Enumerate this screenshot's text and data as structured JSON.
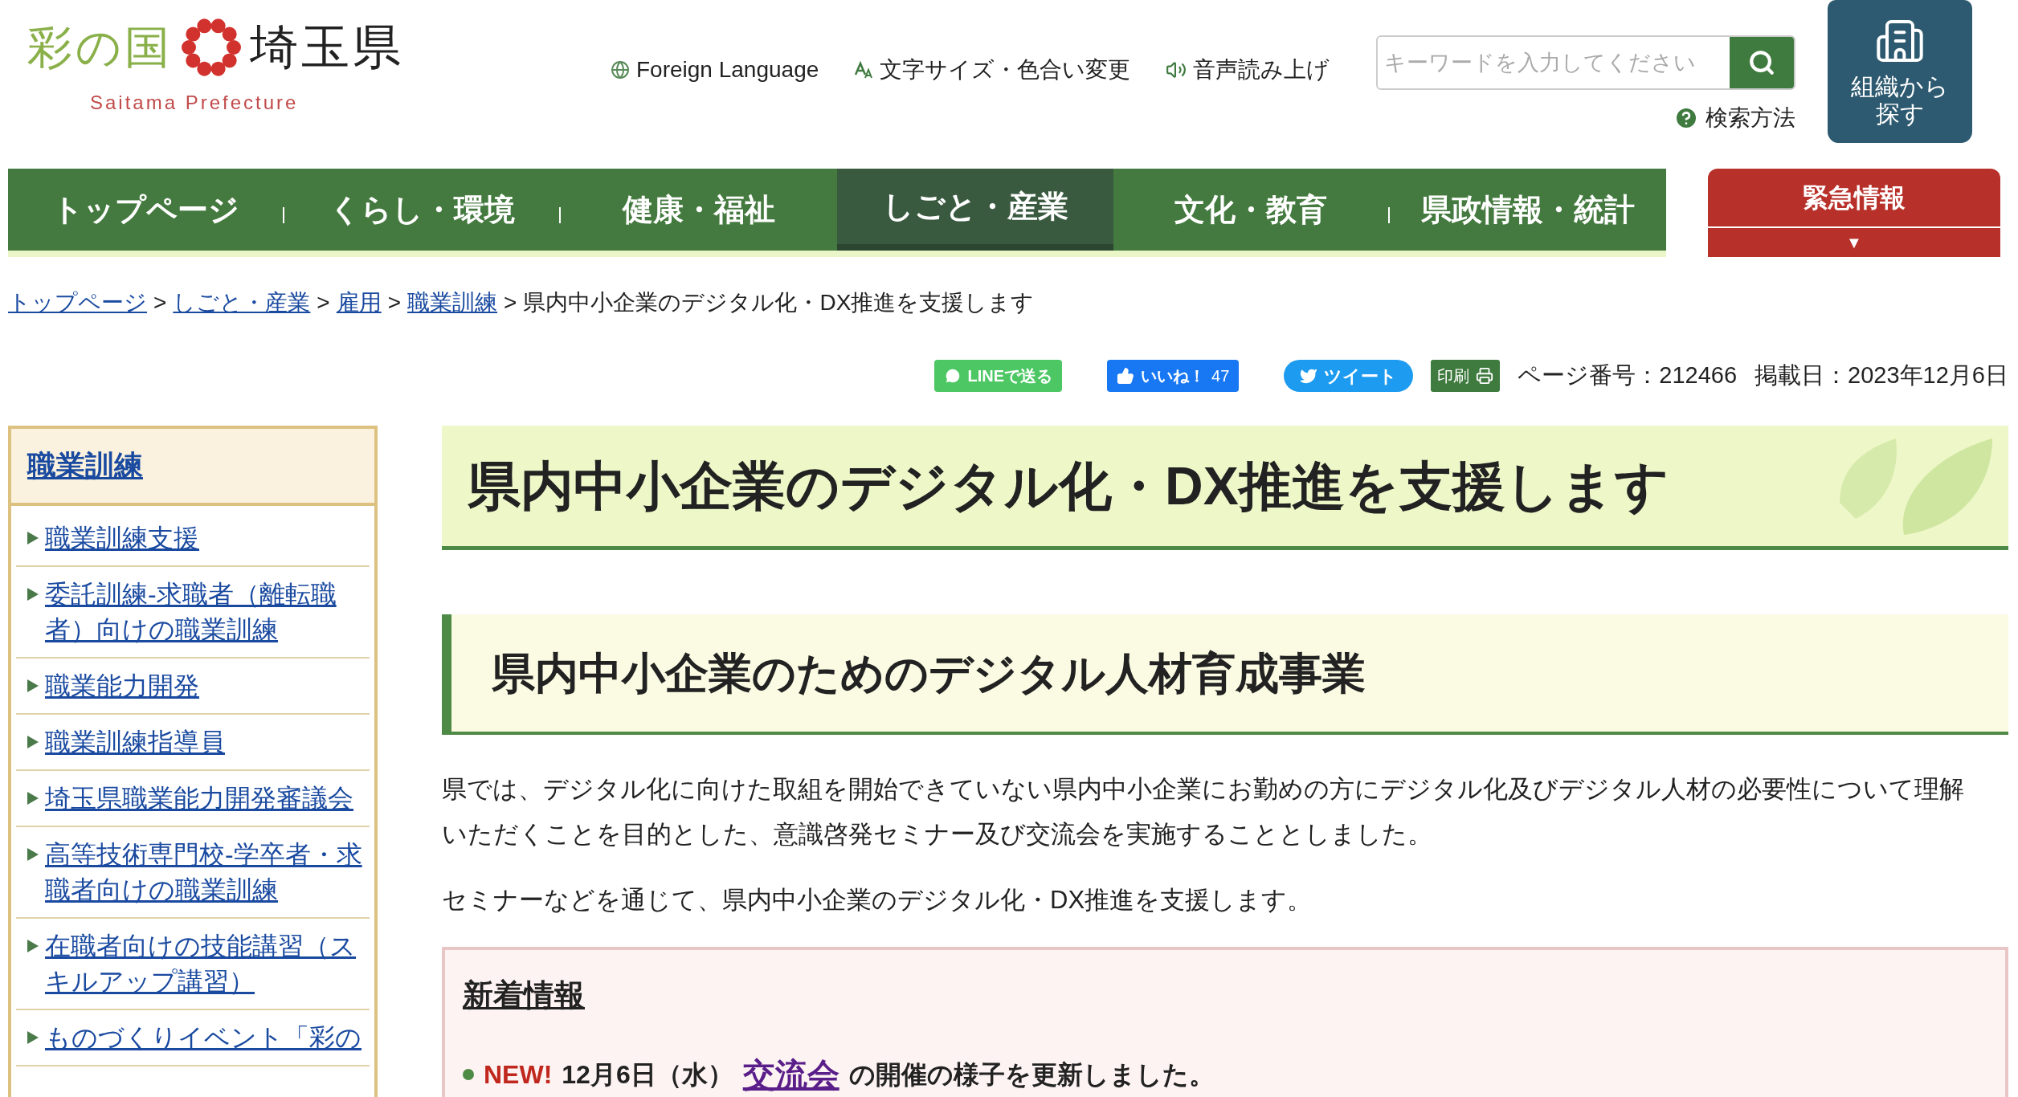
{
  "logo": {
    "mark_text": "彩の国",
    "name": "埼玉県",
    "subtitle": "Saitama Prefecture"
  },
  "header_links": [
    {
      "kind": "globe",
      "label": "Foreign Language"
    },
    {
      "kind": "text-size",
      "label": "文字サイズ・色合い変更"
    },
    {
      "kind": "speaker",
      "label": "音声読み上げ"
    }
  ],
  "search": {
    "placeholder": "キーワードを入力してください",
    "help": "検索方法"
  },
  "org_button": {
    "label": "組織から探す"
  },
  "nav": [
    {
      "label": "トップページ",
      "selected": false
    },
    {
      "label": "くらし・環境",
      "selected": false
    },
    {
      "label": "健康・福祉",
      "selected": false
    },
    {
      "label": "しごと・産業",
      "selected": true
    },
    {
      "label": "文化・教育",
      "selected": false
    },
    {
      "label": "県政情報・統計",
      "selected": false
    }
  ],
  "emergency": {
    "label": "緊急情報",
    "expand_icon": "▼"
  },
  "breadcrumb": {
    "links": [
      "トップページ",
      "しごと・産業",
      "雇用",
      "職業訓練"
    ],
    "separators": [
      ">",
      ">",
      ">",
      ">"
    ],
    "current": "県内中小企業のデジタル化・DX推進を支援します"
  },
  "share": [
    {
      "kind": "line",
      "label": "LINEで送る"
    },
    {
      "kind": "like",
      "label": "いいね！",
      "count": "47"
    },
    {
      "kind": "tweet",
      "label": "ツイート"
    },
    {
      "kind": "print",
      "label": "印刷"
    }
  ],
  "page_number": "ページ番号：212466",
  "posted": "掲載日：2023年12月6日",
  "sidebar": {
    "title": "職業訓練",
    "items": [
      "職業訓練支援",
      "委託訓練-求職者（離転職者）向けの職業訓練",
      "職業能力開発",
      "職業訓練指導員",
      "埼玉県職業能力開発審議会",
      "高等技術専門校-学卒者・求職者向けの職業訓練",
      "在職者向けの技能講習（スキルアップ講習）",
      "ものづくりイベント「彩の"
    ]
  },
  "main": {
    "title": "県内中小企業のデジタル化・DX推進を支援します",
    "section_heading": "県内中小企業のためのデジタル人材育成事業",
    "paragraphs": [
      "県では、デジタル化に向けた取組を開始できていない県内中小企業にお勤めの方にデジタル化及びデジタル人材の必要性について理解いただくことを目的とした、意識啓発セミナー及び交流会を実施することとしました。",
      "セミナーなどを通じて、県内中小企業のデジタル化・DX推進を支援します。"
    ],
    "news": {
      "title": "新着情報",
      "items": [
        {
          "badge": "NEW!",
          "date": "12月6日（水）",
          "link": "交流会",
          "text": "の開催の様子を更新しました。"
        }
      ]
    }
  }
}
